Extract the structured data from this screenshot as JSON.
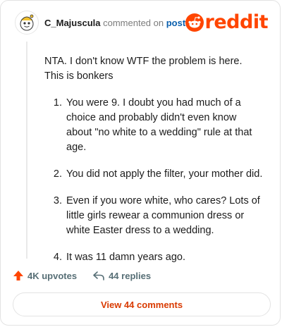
{
  "header": {
    "username": "C_Majuscula",
    "action_text": "commented on",
    "link_text": "post",
    "logo_text": "reddit"
  },
  "comment": {
    "intro": "NTA. I don't know WTF the problem is here. This is bonkers",
    "points": [
      "You were 9. I doubt you had much of a choice and probably didn't even know about \"no white to a wedding\" rule at that age.",
      "You did not apply the filter, your mother did.",
      "Even if you wore white, who cares? Lots of little girls rewear a communion dress or white Easter dress to a wedding.",
      "It was 11 damn years ago."
    ]
  },
  "actions": {
    "upvotes": "4K upvotes",
    "replies": "44 replies"
  },
  "view_button": "View 44 comments",
  "colors": {
    "brand": "#ff4500",
    "link": "#0a5fad",
    "view_button_text": "#d93a00"
  }
}
